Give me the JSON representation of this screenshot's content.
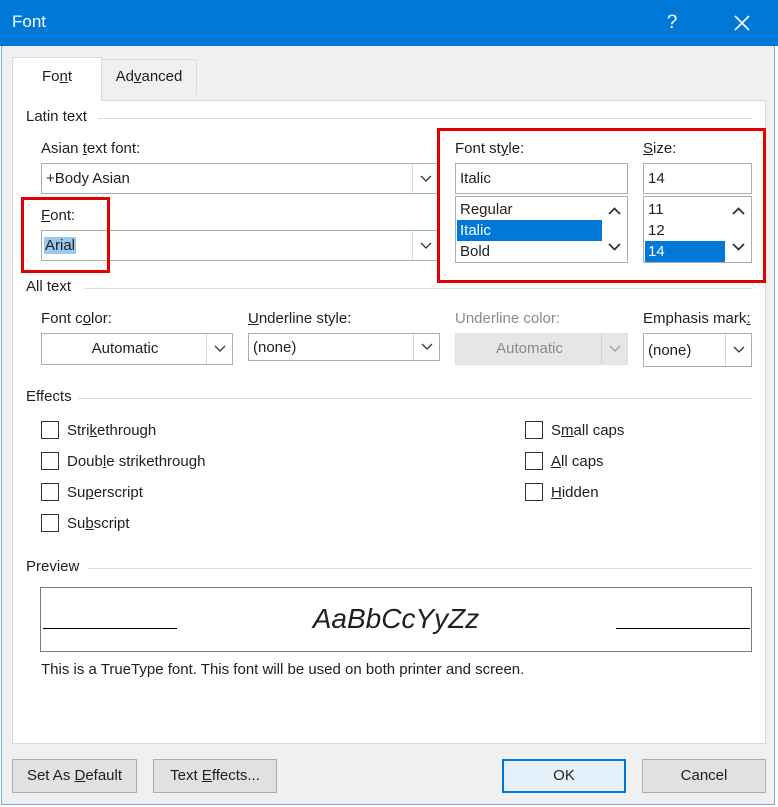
{
  "window": {
    "title": "Font",
    "help_label": "?"
  },
  "tabs": [
    {
      "label": "Font",
      "accel": "n",
      "pre": "Fo",
      "post": "t"
    },
    {
      "label": "Advanced",
      "pre": "Ad",
      "accel": "v",
      "post": "anced"
    }
  ],
  "latin": {
    "section": "Latin text",
    "asian_label_pre": "Asian ",
    "asian_label_accel": "t",
    "asian_label_post": "ext font:",
    "asian_value": "+Body Asian",
    "font_label_accel": "F",
    "font_label_post": "ont:",
    "font_value": "Arial",
    "style_label_pre": "Font st",
    "style_label_accel": "y",
    "style_label_post": "le:",
    "style_value": "Italic",
    "style_options": [
      "Regular",
      "Italic",
      "Bold"
    ],
    "style_selected": 1,
    "size_label_accel": "S",
    "size_label_post": "ize:",
    "size_value": "14",
    "size_options": [
      "11",
      "12",
      "14"
    ],
    "size_selected": 2
  },
  "alltext": {
    "section": "All text",
    "color_label_pre": "Font c",
    "color_label_accel": "o",
    "color_label_post": "lor:",
    "color_value": "Automatic",
    "underline_label_accel": "U",
    "underline_label_post": "nderline style:",
    "underline_value": "(none)",
    "ucolor_label_pre": "Underline color:",
    "ucolor_value": "Automatic",
    "emphasis_label_pre": "Emphasis mark",
    "emphasis_label_post": ":",
    "emphasis_value": "(none)"
  },
  "effects": {
    "section": "Effects",
    "left": [
      {
        "pre": "Stri",
        "accel": "k",
        "post": "ethrough"
      },
      {
        "pre": "Doub",
        "accel": "l",
        "post": "e strikethrough"
      },
      {
        "pre": "Su",
        "accel": "p",
        "post": "erscript"
      },
      {
        "pre": "Su",
        "accel": "b",
        "post": "script"
      }
    ],
    "right": [
      {
        "pre": "S",
        "accel": "m",
        "post": "all caps"
      },
      {
        "pre": "",
        "accel": "A",
        "post": "ll caps"
      },
      {
        "pre": "",
        "accel": "H",
        "post": "idden"
      }
    ]
  },
  "preview": {
    "section": "Preview",
    "sample": "AaBbCcYyZz",
    "note": "This is a TrueType font. This font will be used on both printer and screen."
  },
  "buttons": {
    "default_pre": "Set As ",
    "default_accel": "D",
    "default_post": "efault",
    "effects_pre": "Text ",
    "effects_accel": "E",
    "effects_post": "ffects...",
    "ok": "OK",
    "cancel": "Cancel"
  },
  "colors": {
    "titlebar": "#0078d7",
    "selection": "#0078d7",
    "highlight": "#e00000"
  }
}
